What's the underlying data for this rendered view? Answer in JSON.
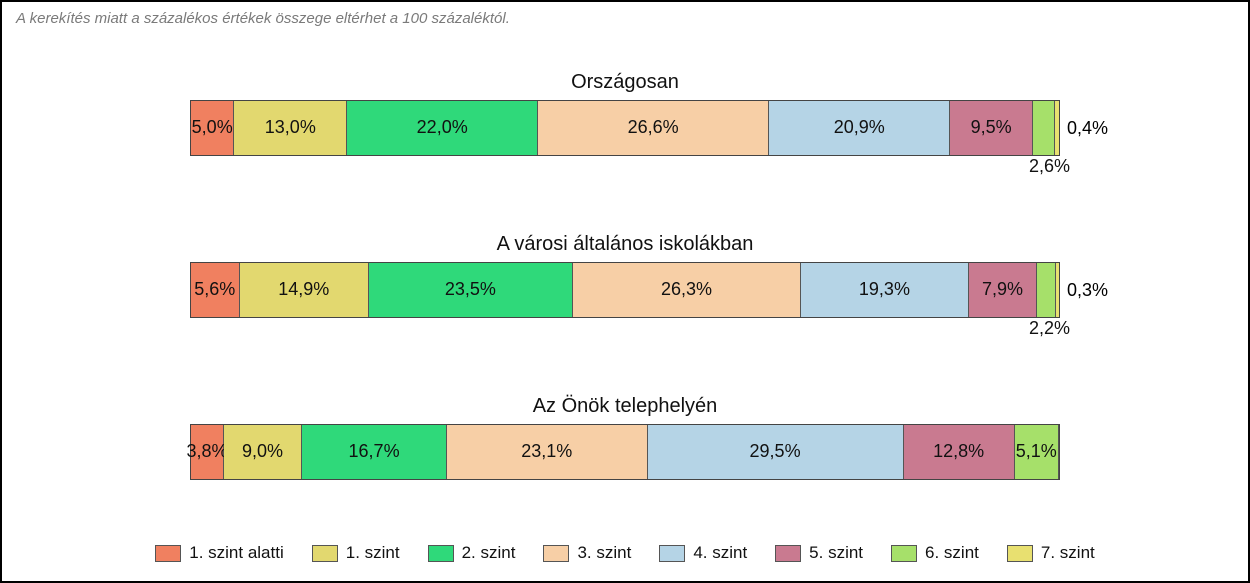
{
  "note": "A kerekítés miatt a százalékos értékek összege eltérhet a 100 százaléktól.",
  "legend": [
    "1. szint alatti",
    "1. szint",
    "2. szint",
    "3. szint",
    "4. szint",
    "5. szint",
    "6. szint",
    "7. szint"
  ],
  "groups": [
    {
      "title": "Országosan",
      "labels": [
        "5,0%",
        "13,0%",
        "22,0%",
        "26,6%",
        "20,9%",
        "9,5%",
        "0,4%",
        "2,6%"
      ],
      "values": [
        5.0,
        13.0,
        22.0,
        26.6,
        20.9,
        9.5,
        2.6,
        0.4
      ]
    },
    {
      "title": "A városi általános iskolákban",
      "labels": [
        "5,6%",
        "14,9%",
        "23,5%",
        "26,3%",
        "19,3%",
        "7,9%",
        "0,3%",
        "2,2%"
      ],
      "values": [
        5.6,
        14.9,
        23.5,
        26.3,
        19.3,
        7.9,
        2.2,
        0.3
      ]
    },
    {
      "title": "Az Önök telephelyén",
      "labels": [
        "3,8%",
        "9,0%",
        "16,7%",
        "23,1%",
        "29,5%",
        "12,8%",
        "5,1%",
        ""
      ],
      "values": [
        3.8,
        9.0,
        16.7,
        23.1,
        29.5,
        12.8,
        5.1,
        0.0
      ]
    }
  ],
  "chart_data": {
    "type": "bar",
    "stacked": true,
    "orientation": "horizontal",
    "unit": "percent",
    "categories": [
      "Országosan",
      "A városi általános iskolákban",
      "Az Önök telephelyén"
    ],
    "levels": [
      "1. szint alatti",
      "1. szint",
      "2. szint",
      "3. szint",
      "4. szint",
      "5. szint",
      "6. szint",
      "7. szint"
    ],
    "series": [
      {
        "name": "1. szint alatti",
        "values": [
          5.0,
          5.6,
          3.8
        ]
      },
      {
        "name": "1. szint",
        "values": [
          13.0,
          14.9,
          9.0
        ]
      },
      {
        "name": "2. szint",
        "values": [
          22.0,
          23.5,
          16.7
        ]
      },
      {
        "name": "3. szint",
        "values": [
          26.6,
          26.3,
          23.1
        ]
      },
      {
        "name": "4. szint",
        "values": [
          20.9,
          19.3,
          29.5
        ]
      },
      {
        "name": "5. szint",
        "values": [
          9.5,
          7.9,
          12.8
        ]
      },
      {
        "name": "6. szint",
        "values": [
          2.6,
          2.2,
          5.1
        ]
      },
      {
        "name": "7. szint",
        "values": [
          0.4,
          0.3,
          0.0
        ]
      }
    ],
    "xlim": [
      0,
      100
    ],
    "note": "A kerekítés miatt a százalékos értékek összege eltérhet a 100 százaléktól."
  }
}
